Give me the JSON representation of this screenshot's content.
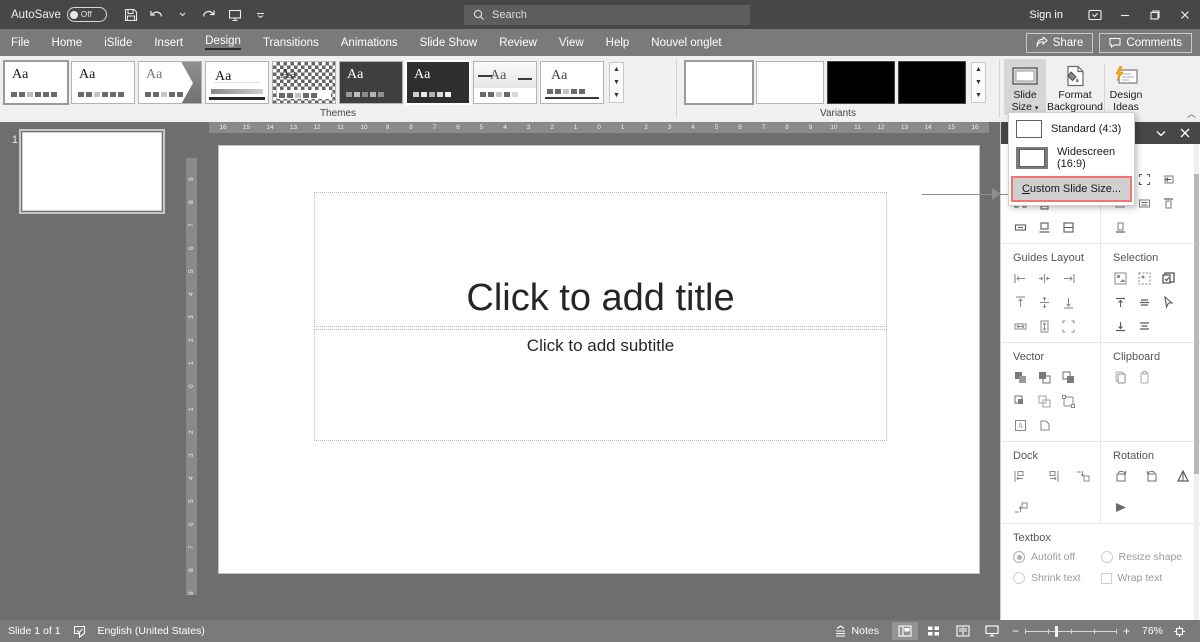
{
  "titlebar": {
    "autosave_label": "AutoSave",
    "autosave_state": "Off",
    "quick_access": [
      {
        "name": "save-button",
        "icon": "save-icon"
      },
      {
        "name": "undo-button",
        "icon": "undo-icon"
      },
      {
        "name": "redo-button",
        "icon": "redo-icon"
      },
      {
        "name": "start-presentation-button",
        "icon": "presentation-icon"
      },
      {
        "name": "customize-quick-access-button",
        "icon": "chevron-down-icon"
      }
    ],
    "search_placeholder": "Search",
    "sign_in": "Sign in",
    "ribbon_display_options": "ribbon-display-icon",
    "minimize": "minimize-icon",
    "restore": "restore-icon",
    "close": "close-icon"
  },
  "tabs": [
    {
      "label": "File",
      "active": false
    },
    {
      "label": "Home",
      "active": false
    },
    {
      "label": "iSlide",
      "active": false
    },
    {
      "label": "Insert",
      "active": false
    },
    {
      "label": "Design",
      "active": true
    },
    {
      "label": "Transitions",
      "active": false
    },
    {
      "label": "Animations",
      "active": false
    },
    {
      "label": "Slide Show",
      "active": false
    },
    {
      "label": "Review",
      "active": false
    },
    {
      "label": "View",
      "active": false
    },
    {
      "label": "Help",
      "active": false
    },
    {
      "label": "Nouvel onglet",
      "active": false
    }
  ],
  "tab_actions": {
    "share": "Share",
    "comments": "Comments"
  },
  "ribbon": {
    "themes_label": "Themes",
    "variants_label": "Variants",
    "themes": [
      {
        "name": "theme-office",
        "style": "light",
        "selected": true
      },
      {
        "name": "theme-plain",
        "style": "light",
        "selected": false
      },
      {
        "name": "theme-facet",
        "style": "light-fold",
        "selected": false
      },
      {
        "name": "theme-banded",
        "style": "light-band",
        "selected": false
      },
      {
        "name": "theme-pattern",
        "style": "pattern",
        "selected": false
      },
      {
        "name": "theme-dark-one",
        "style": "dark",
        "selected": false
      },
      {
        "name": "theme-dark-two",
        "style": "dark",
        "selected": false
      },
      {
        "name": "theme-lines",
        "style": "light-lines",
        "selected": false
      },
      {
        "name": "theme-simple",
        "style": "light",
        "selected": false
      }
    ],
    "variants": [
      {
        "name": "variant-white-1",
        "style": "white",
        "selected": true
      },
      {
        "name": "variant-white-2",
        "style": "white",
        "selected": false
      },
      {
        "name": "variant-black-1",
        "style": "black",
        "selected": false
      },
      {
        "name": "variant-black-2",
        "style": "black",
        "selected": false
      }
    ],
    "buttons": [
      {
        "name": "slide-size-button",
        "label_line1": "Slide",
        "label_line2": "Size",
        "icon": "slide-size-icon",
        "active": true,
        "has_caret": true
      },
      {
        "name": "format-background-button",
        "label_line1": "Format",
        "label_line2": "Background",
        "icon": "format-background-icon",
        "active": false,
        "has_caret": false
      },
      {
        "name": "design-ideas-button",
        "label_line1": "Design",
        "label_line2": "Ideas",
        "icon": "design-ideas-icon",
        "active": false,
        "has_caret": false
      }
    ]
  },
  "slide_size_menu": {
    "standard": "Standard (4:3)",
    "widescreen": "Widescreen (16:9)",
    "custom_accel": "C",
    "custom_rest": "ustom Slide Size...",
    "highlight_color": "#f4736e"
  },
  "thumbnails": {
    "slides": [
      {
        "number": "1"
      }
    ]
  },
  "rulers": {
    "horizontal": [
      "16",
      "15",
      "14",
      "13",
      "12",
      "11",
      "10",
      "9",
      "8",
      "7",
      "6",
      "5",
      "4",
      "3",
      "2",
      "1",
      "0",
      "1",
      "2",
      "3",
      "4",
      "5",
      "6",
      "7",
      "8",
      "9",
      "10",
      "11",
      "12",
      "13",
      "14",
      "15",
      "16"
    ],
    "vertical": [
      "9",
      "8",
      "7",
      "6",
      "5",
      "4",
      "3",
      "2",
      "1",
      "0",
      "1",
      "2",
      "3",
      "4",
      "5",
      "6",
      "7",
      "8",
      "9"
    ]
  },
  "slide": {
    "title_placeholder": "Click to add title",
    "subtitle_placeholder": "Click to add subtitle"
  },
  "islide_panel": {
    "sections": [
      {
        "name": "guides-layout",
        "title": "Guides Layout",
        "icons": [
          "align-left-guide-icon",
          "align-center-guide-icon",
          "align-right-guide-icon",
          "align-top-guide-icon",
          "align-middle-guide-icon",
          "align-bottom-guide-icon",
          "distribute-horizontal-icon",
          "distribute-vertical-icon",
          "fit-guides-icon"
        ]
      },
      {
        "name": "selection",
        "title": "Selection",
        "icons": [
          "select-all-icon",
          "select-similar-icon",
          "select-invert-icon",
          "select-top-icon",
          "select-middle-icon",
          "select-pointer-icon",
          "select-bottom-icon",
          "select-rows-icon"
        ]
      },
      {
        "name": "vector",
        "title": "Vector",
        "icons": [
          "union-icon",
          "combine-icon",
          "fragment-icon",
          "intersect-icon",
          "subtract-icon",
          "edit-points-icon",
          "text-to-shape-icon",
          "shape-convert-icon"
        ]
      },
      {
        "name": "clipboard",
        "title": "Clipboard",
        "icons": [
          "copy-icon",
          "paste-icon"
        ]
      },
      {
        "name": "dock",
        "title": "Dock",
        "icons": [
          "dock-left-icon",
          "dock-right-icon",
          "dock-top-icon",
          "dock-bottom-icon"
        ]
      },
      {
        "name": "rotation",
        "title": "Rotation",
        "icons": [
          "rotate-right-icon",
          "rotate-left-icon",
          "flip-vertical-icon",
          "flip-horizontal-icon"
        ]
      }
    ],
    "textbox": {
      "title": "Textbox",
      "options": [
        {
          "name": "autofit-off-radio",
          "label": "Autofit off",
          "type": "radio",
          "selected": true
        },
        {
          "name": "resize-shape-radio",
          "label": "Resize shape",
          "type": "radio",
          "selected": false
        },
        {
          "name": "shrink-text-radio",
          "label": "Shrink text",
          "type": "radio",
          "selected": false
        },
        {
          "name": "wrap-text-checkbox",
          "label": "Wrap text",
          "type": "checkbox",
          "selected": false
        }
      ]
    }
  },
  "statusbar": {
    "slide_count": "Slide 1 of 1",
    "accessibility_icon": "accessibility-icon",
    "language": "English (United States)",
    "notes": "Notes",
    "views": [
      {
        "name": "normal-view-button",
        "icon": "normal-view-icon",
        "active": true
      },
      {
        "name": "slide-sorter-button",
        "icon": "slide-sorter-icon",
        "active": false
      },
      {
        "name": "reading-view-button",
        "icon": "reading-view-icon",
        "active": false
      },
      {
        "name": "slideshow-button",
        "icon": "slideshow-icon",
        "active": false
      }
    ],
    "zoom_out": "−",
    "zoom_in": "+",
    "zoom_value": "76%",
    "fit_to_window": "fit-to-window-icon"
  }
}
